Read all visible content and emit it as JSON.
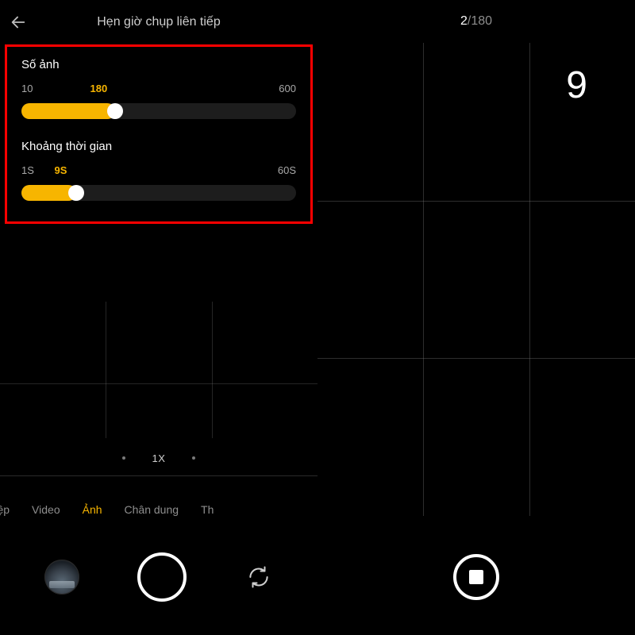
{
  "left": {
    "title": "Hẹn giờ chụp liên tiếp",
    "settings": {
      "count": {
        "label": "Số ảnh",
        "min": "10",
        "value": "180",
        "max": "600",
        "fill_pct": 34
      },
      "interval": {
        "label": "Khoảng thời gian",
        "min": "1S",
        "value": "9S",
        "max": "60S",
        "fill_pct": 20
      }
    },
    "zoom": "1X",
    "modes": {
      "pro": "nghiệp",
      "video": "Video",
      "photo": "Ảnh",
      "portrait": "Chân dung",
      "more": "Th"
    }
  },
  "right": {
    "progress_current": "2",
    "progress_total": "180",
    "countdown": "9"
  },
  "colors": {
    "accent": "#f7b500",
    "highlight": "#ff0000"
  }
}
